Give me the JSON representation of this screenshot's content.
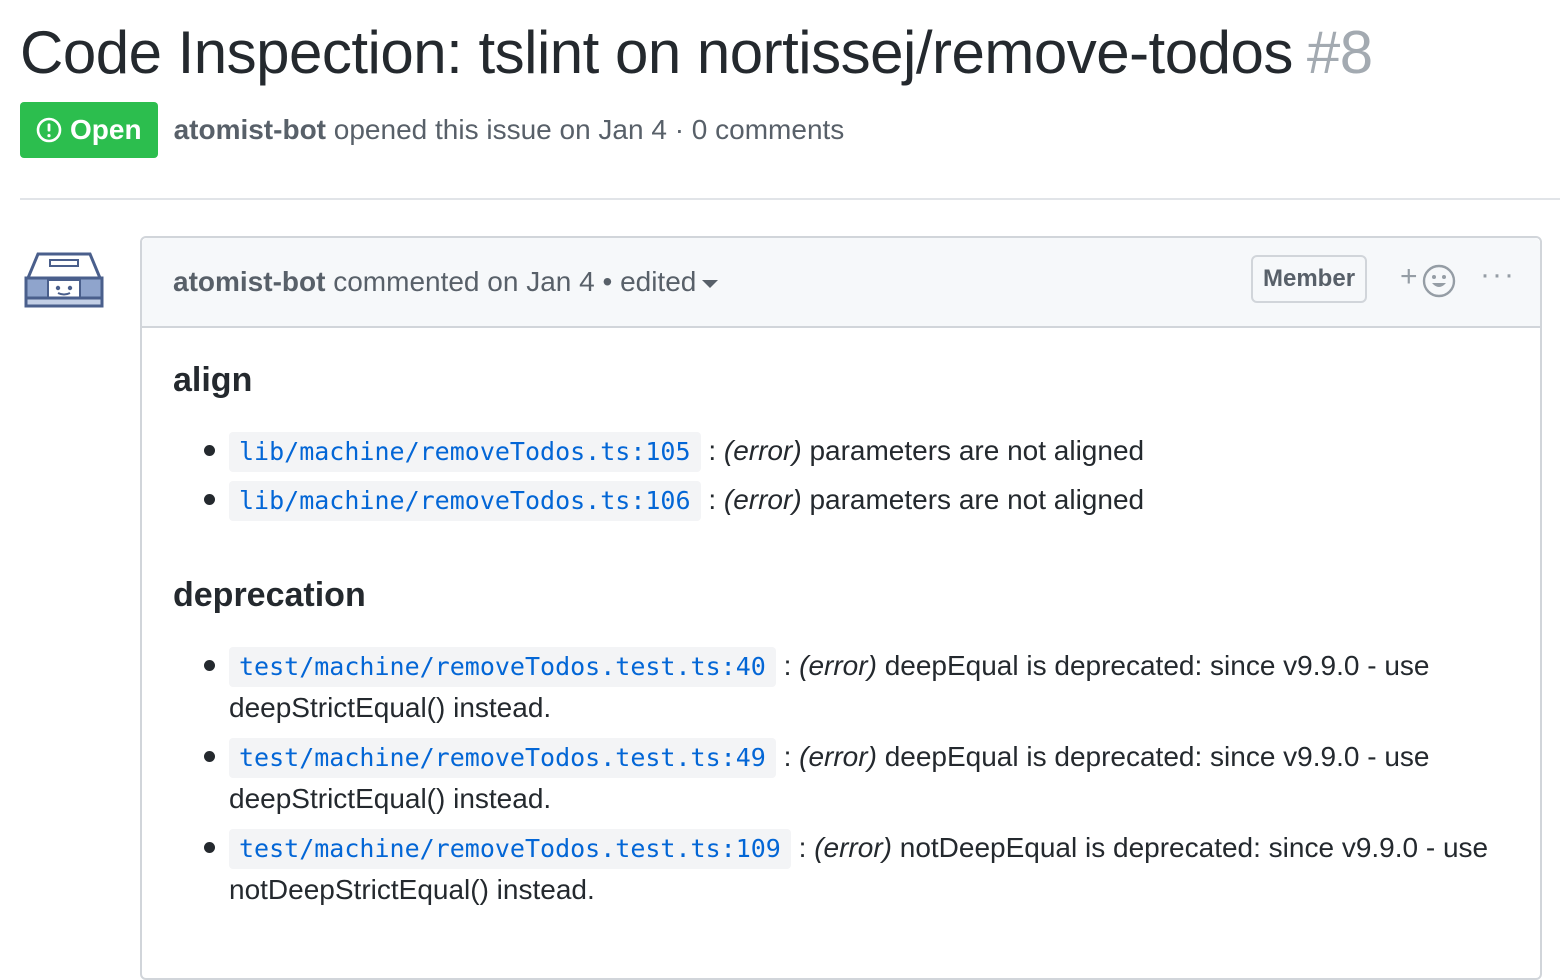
{
  "issue": {
    "title": "Code Inspection: tslint on nortissej/remove-todos",
    "number": "#8",
    "state": "Open",
    "author": "atomist-bot",
    "opened_text": "opened this issue on Jan 4 · 0 comments"
  },
  "comment": {
    "author": "atomist-bot",
    "meta_text": "commented on Jan 4 • edited",
    "role_badge": "Member",
    "reaction_plus": "+",
    "more": "···",
    "sections": [
      {
        "heading": "align",
        "items": [
          {
            "location": "lib/machine/removeTodos.ts:105",
            "separator": ":",
            "severity": "(error)",
            "message": "parameters are not aligned"
          },
          {
            "location": "lib/machine/removeTodos.ts:106",
            "separator": ":",
            "severity": "(error)",
            "message": "parameters are not aligned"
          }
        ]
      },
      {
        "heading": "deprecation",
        "items": [
          {
            "location": "test/machine/removeTodos.test.ts:40",
            "separator": ":",
            "severity": "(error)",
            "message": "deepEqual is deprecated: since v9.9.0 - use deepStrictEqual() instead."
          },
          {
            "location": "test/machine/removeTodos.test.ts:49",
            "separator": ":",
            "severity": "(error)",
            "message": "deepEqual is deprecated: since v9.9.0 - use deepStrictEqual() instead."
          },
          {
            "location": "test/machine/removeTodos.test.ts:109",
            "separator": ":",
            "severity": "(error)",
            "message": "notDeepEqual is deprecated: since v9.9.0 - use notDeepStrictEqual() instead."
          }
        ]
      }
    ]
  },
  "colors": {
    "open_green": "#2cbe4e",
    "link_blue": "#0366d6",
    "muted": "#586069",
    "header_bg": "#f6f8fa"
  },
  "icons": {
    "state": "issue-opened-icon",
    "avatar": "atomist-bot-avatar",
    "reaction": "smiley-icon",
    "more": "kebab-horizontal-icon",
    "edited_dropdown": "triangle-down-icon"
  }
}
